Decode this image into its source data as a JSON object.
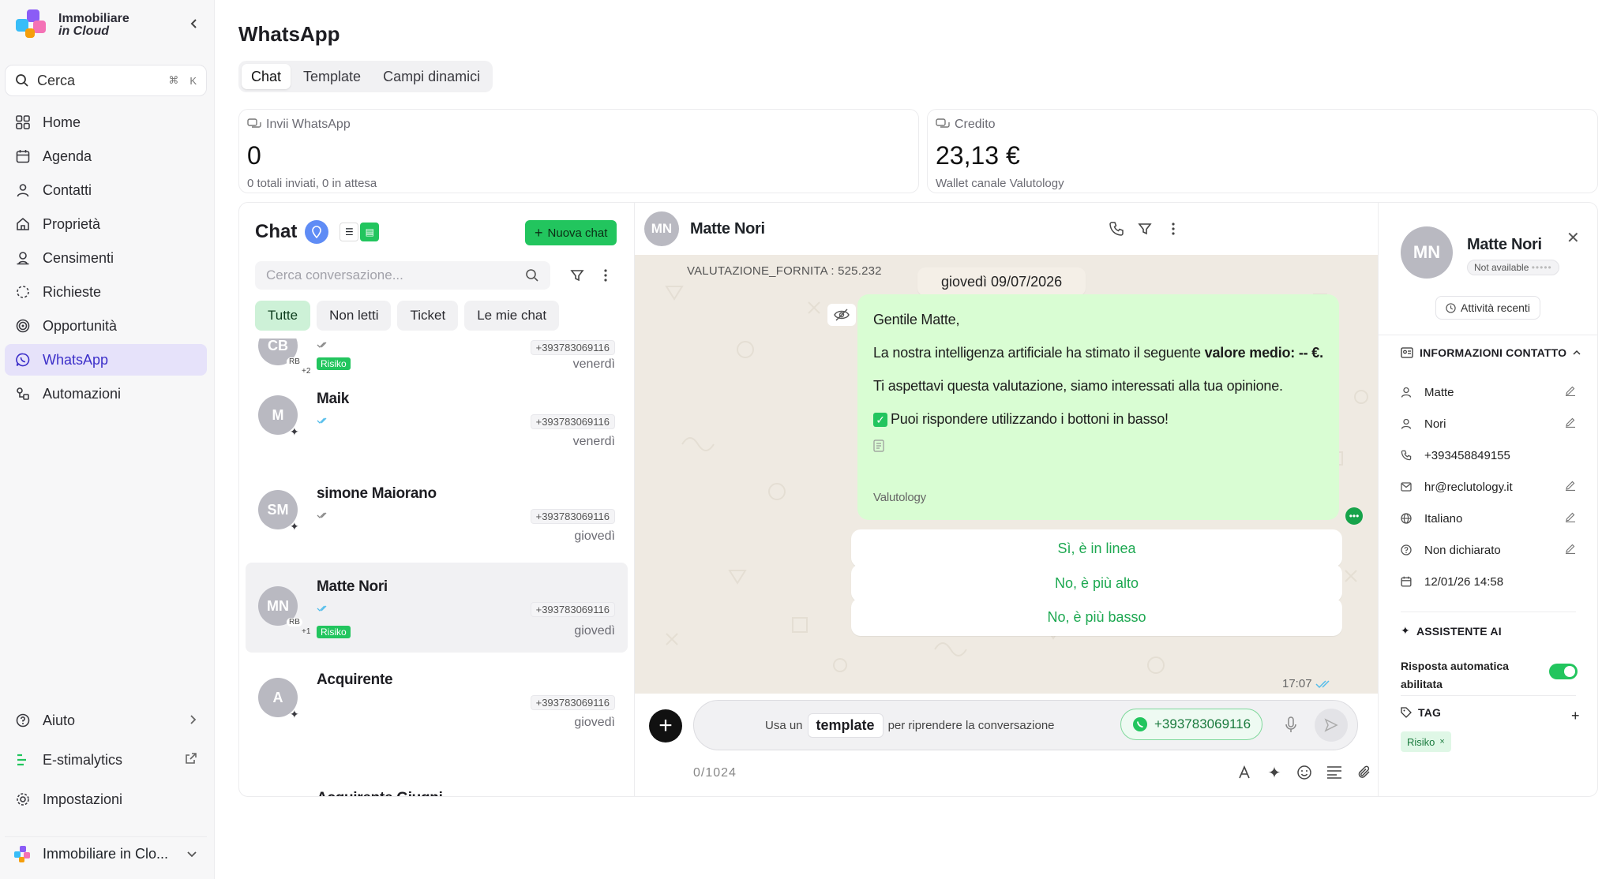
{
  "brand": {
    "line1": "Immobiliare",
    "line2": "in Cloud"
  },
  "search": {
    "label": "Cerca",
    "kbd1": "⌘",
    "kbd2": "K"
  },
  "nav": [
    {
      "label": "Home",
      "icon": "grid-icon"
    },
    {
      "label": "Agenda",
      "icon": "calendar-icon"
    },
    {
      "label": "Contatti",
      "icon": "user-icon"
    },
    {
      "label": "Proprietà",
      "icon": "house-icon"
    },
    {
      "label": "Censimenti",
      "icon": "user-pin-icon"
    },
    {
      "label": "Richieste",
      "icon": "dashed-circle-icon"
    },
    {
      "label": "Opportunità",
      "icon": "target-icon"
    },
    {
      "label": "WhatsApp",
      "icon": "whatsapp-icon"
    },
    {
      "label": "Automazioni",
      "icon": "automation-icon"
    }
  ],
  "nav_bottom": {
    "help": "Aiuto",
    "estimalytics": "E-stimalytics",
    "settings": "Impostazioni",
    "workspace": "Immobiliare in Clo..."
  },
  "page": {
    "title": "WhatsApp",
    "tabs": [
      "Chat",
      "Template",
      "Campi dinamici"
    ]
  },
  "stats": {
    "sends": {
      "label": "Invii WhatsApp",
      "value": "0",
      "sub": "0 totali inviati, 0 in attesa"
    },
    "credit": {
      "label": "Credito",
      "value": "23,13 €",
      "sub": "Wallet canale Valutology"
    }
  },
  "chat_list": {
    "title": "Chat",
    "new_chat": "Nuova chat",
    "search_placeholder": "Cerca conversazione...",
    "filters": [
      "Tutte",
      "Non letti",
      "Ticket",
      "Le mie chat"
    ],
    "conversations": [
      {
        "initials": "CB",
        "name": "",
        "phone": "+393783069116",
        "date": "venerdì",
        "badge": "RB",
        "count": "+2",
        "tag": "Risiko"
      },
      {
        "initials": "M",
        "name": "Maik",
        "phone": "+393783069116",
        "date": "venerdì"
      },
      {
        "initials": "SM",
        "name": "simone Maiorano",
        "phone": "+393783069116",
        "date": "giovedì"
      },
      {
        "initials": "MN",
        "name": "Matte Nori",
        "phone": "+393783069116",
        "date": "giovedì",
        "badge": "RB",
        "count": "+1",
        "tag": "Risiko"
      },
      {
        "initials": "A",
        "name": "Acquirente",
        "phone": "+393783069116",
        "date": "giovedì"
      },
      {
        "initials": "",
        "name": "Acquirente Giugni",
        "phone": "",
        "date": ""
      }
    ]
  },
  "chat": {
    "contact_initials": "MN",
    "contact_name": "Matte Nori",
    "system_line": "VALUTAZIONE_FORNITA : 525.232",
    "date": "giovedì 09/07/2026",
    "message": {
      "greeting": "Gentile Matte,",
      "line1_pre": "La nostra intelligenza artificiale ha stimato il seguente ",
      "line1_bold": "valore medio: -- €.",
      "line2": "Ti aspettavi questa valutazione, siamo interessati alla tua opinione.",
      "line3": "Puoi rispondere utilizzando i bottoni in basso!",
      "sender": "Valutology"
    },
    "replies": [
      "Sì, è in linea",
      "No, è più alto",
      "No, è più basso"
    ],
    "time": "17:07",
    "composer": {
      "hint_pre": "Usa un",
      "template": "template",
      "hint_post": "per riprendere la conversazione",
      "phone": "+393783069116",
      "counter": "0/1024"
    }
  },
  "contact": {
    "initials": "MN",
    "name": "Matte Nori",
    "availability": "Not available",
    "recent": "Attività recenti",
    "info_title": "INFORMAZIONI CONTATTO",
    "fields": [
      "Matte",
      "Nori",
      "+393458849155",
      "hr@reclutology.it",
      "Italiano",
      "Non dichiarato",
      "12/01/26 14:58"
    ],
    "ai_title": "ASSISTENTE AI",
    "auto_reply": "Risposta automatica abilitata",
    "tag_title": "TAG",
    "tag": "Risiko"
  },
  "colors": {
    "accent": "#3c2fc9",
    "green": "#22c55e",
    "chat_bg": "#efeae2",
    "bubble": "#d9fdd3"
  }
}
